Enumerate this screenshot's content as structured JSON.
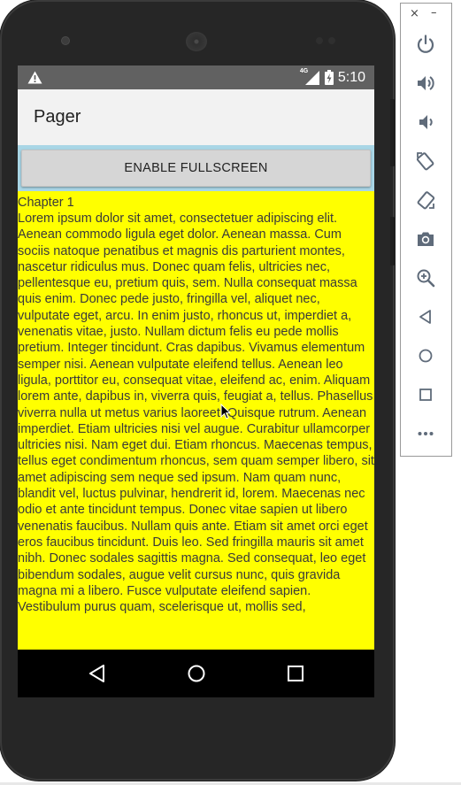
{
  "status_bar": {
    "time": "5:10",
    "network_label": "4G",
    "warning_icon": "warning-icon",
    "battery_icon": "battery-charging-icon"
  },
  "app_bar": {
    "title": "Pager"
  },
  "actions": {
    "fullscreen_label": "ENABLE FULLSCREEN"
  },
  "content": {
    "chapter_title": "Chapter 1",
    "body": "Lorem ipsum dolor sit amet, consectetuer adipiscing elit. Aenean commodo ligula eget dolor. Aenean massa. Cum sociis natoque penatibus et magnis dis parturient montes, nascetur ridiculus mus. Donec quam felis, ultricies nec, pellentesque eu, pretium quis, sem. Nulla consequat massa quis enim. Donec pede justo, fringilla vel, aliquet nec, vulputate eget, arcu. In enim justo, rhoncus ut, imperdiet a, venenatis vitae, justo. Nullam dictum felis eu pede mollis pretium. Integer tincidunt. Cras dapibus. Vivamus elementum semper nisi. Aenean vulputate eleifend tellus. Aenean leo ligula, porttitor eu, consequat vitae, eleifend ac, enim. Aliquam lorem ante, dapibus in, viverra quis, feugiat a, tellus. Phasellus viverra nulla ut metus varius laoreet. Quisque rutrum. Aenean imperdiet. Etiam ultricies nisi vel augue. Curabitur ullamcorper ultricies nisi. Nam eget dui. Etiam rhoncus. Maecenas tempus, tellus eget condimentum rhoncus, sem quam semper libero, sit amet adipiscing sem neque sed ipsum. Nam quam nunc, blandit vel, luctus pulvinar, hendrerit id, lorem. Maecenas nec odio et ante tincidunt tempus. Donec vitae sapien ut libero venenatis faucibus. Nullam quis ante. Etiam sit amet orci eget eros faucibus tincidunt. Duis leo. Sed fringilla mauris sit amet nibh. Donec sodales sagittis magna. Sed consequat, leo eget bibendum sodales, augue velit cursus nunc, quis gravida magna mi a libero. Fusce vulputate eleifend sapien. Vestibulum purus quam, scelerisque ut, mollis sed,"
  },
  "nav_bar": {
    "buttons": [
      "back-icon",
      "home-icon",
      "recents-icon"
    ]
  },
  "emulator_toolbar": {
    "close_glyph": "×",
    "minimize_glyph": "–",
    "tools": [
      "power-icon",
      "volume-up-icon",
      "volume-down-icon",
      "rotate-left-icon",
      "rotate-right-icon",
      "camera-icon",
      "zoom-icon",
      "back-icon",
      "home-icon",
      "overview-icon",
      "more-icon"
    ]
  },
  "colors": {
    "content_background": "#ffff00",
    "button_strip": "#a9d6e6",
    "status_bar": "#616161",
    "app_bar": "#f2f2f2",
    "phone_body": "#262626",
    "toolbar_icon": "#5f6b7a"
  }
}
